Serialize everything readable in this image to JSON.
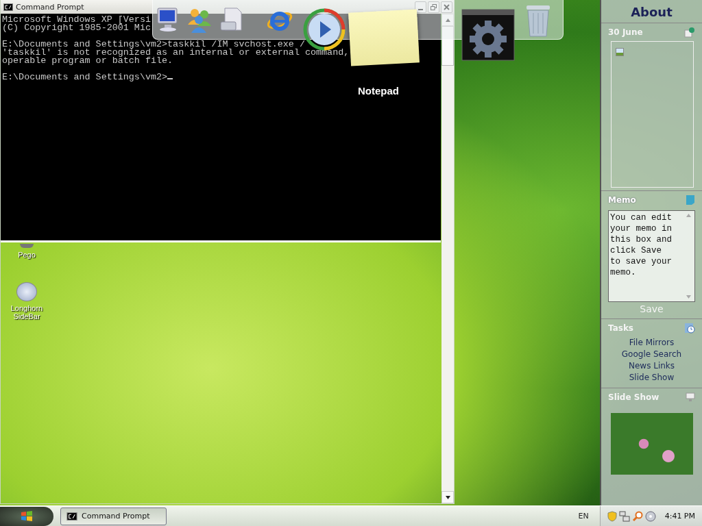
{
  "command_window": {
    "title": "Command Prompt",
    "blocks": [
      [
        "Microsoft Windows XP [Versi",
        "(C) Copyright 1985-2001 Mic"
      ],
      [
        "E:\\Documents and Settings\\vm2>taskkil /IM svchost.exe /",
        "'taskkil' is not recognized as an internal or external command,",
        "operable program or batch file."
      ],
      [
        "E:\\Documents and Settings\\vm2>"
      ]
    ]
  },
  "dock": {
    "label": "Notepad"
  },
  "desktop_icons": [
    {
      "label": "Pego"
    },
    {
      "label": "Longhorn SideBar"
    }
  ],
  "sidebar": {
    "title": "About",
    "date": "30 June",
    "memo": {
      "title": "Memo",
      "text": "You can edit your memo in this box and click Save to save your memo.",
      "button": "Save"
    },
    "tasks": {
      "title": "Tasks",
      "links": [
        "File Mirrors",
        "Google Search",
        "News Links",
        "Slide Show"
      ]
    },
    "slideshow": {
      "title": "Slide Show"
    }
  },
  "taskbar": {
    "buttons": [
      {
        "label": "Command Prompt",
        "selected": true
      }
    ],
    "language": "EN",
    "clock": "4:41 PM"
  }
}
